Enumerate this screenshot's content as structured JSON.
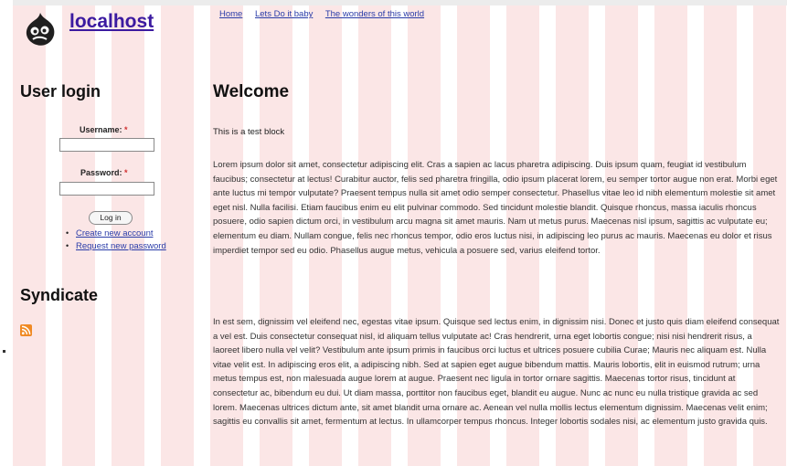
{
  "header": {
    "site_name": "localhost",
    "primary_links": [
      "Home",
      "Lets Do it baby",
      "The wonders of this world"
    ]
  },
  "sidebar": {
    "login": {
      "title": "User login",
      "username_label": "Username:",
      "password_label": "Password:",
      "required_mark": "*",
      "username_value": "",
      "password_value": "",
      "login_button": "Log in",
      "links": [
        "Create new account",
        "Request new password"
      ]
    },
    "syndicate": {
      "title": "Syndicate",
      "feed_icon": "rss-feed-icon"
    }
  },
  "main": {
    "title": "Welcome",
    "intro": "This is a test block",
    "paragraphs": [
      "Lorem ipsum dolor sit amet, consectetur adipiscing elit. Cras a sapien ac lacus pharetra adipiscing. Duis ipsum quam, feugiat id vestibulum faucibus; consectetur at lectus! Curabitur auctor, felis sed pharetra fringilla, odio ipsum placerat lorem, eu semper tortor augue non erat. Morbi eget ante luctus mi tempor vulputate? Praesent tempus nulla sit amet odio semper consectetur. Phasellus vitae leo id nibh elementum molestie sit amet eget nisl. Nulla facilisi. Etiam faucibus enim eu elit pulvinar commodo. Sed tincidunt molestie blandit. Quisque rhoncus, massa iaculis rhoncus posuere, odio sapien dictum orci, in vestibulum arcu magna sit amet mauris. Nam ut metus purus. Maecenas nisl ipsum, sagittis ac vulputate eu; elementum eu diam. Nullam congue, felis nec rhoncus tempor, odio eros luctus nisi, in adipiscing leo purus ac mauris. Maecenas eu dolor et risus imperdiet tempor sed eu odio. Phasellus augue metus, vehicula a posuere sed, varius eleifend tortor.",
      "In est sem, dignissim vel eleifend nec, egestas vitae ipsum. Quisque sed lectus enim, in dignissim nisi. Donec et justo quis diam eleifend consequat a vel est. Duis consectetur consequat nisl, id aliquam tellus vulputate ac! Cras hendrerit, urna eget lobortis congue; nisi nisi hendrerit risus, a laoreet libero nulla vel velit? Vestibulum ante ipsum primis in faucibus orci luctus et ultrices posuere cubilia Curae; Mauris nec aliquam est. Nulla vitae velit est. In adipiscing eros elit, a adipiscing nibh. Sed at sapien eget augue bibendum mattis. Mauris lobortis, elit in euismod rutrum; urna metus tempus est, non malesuada augue lorem at augue. Praesent nec ligula in tortor ornare sagittis. Maecenas tortor risus, tincidunt at consectetur ac, bibendum eu dui. Ut diam massa, porttitor non faucibus eget, blandit eu augue. Nunc ac nunc eu nulla tristique gravida ac sed lorem. Maecenas ultrices dictum ante, sit amet blandit urna ornare ac. Aenean vel nulla mollis lectus elementum dignissim. Maecenas velit enim; sagittis eu convallis sit amet, fermentum at lectus. In ullamcorper tempus rhoncus. Integer lobortis sodales nisi, ac elementum justo gravida quis."
    ]
  },
  "colors": {
    "stripe": "#fbe6e6",
    "link": "#2a3ca8",
    "site_name": "#3b1aa0",
    "rss": "#f08a24"
  }
}
